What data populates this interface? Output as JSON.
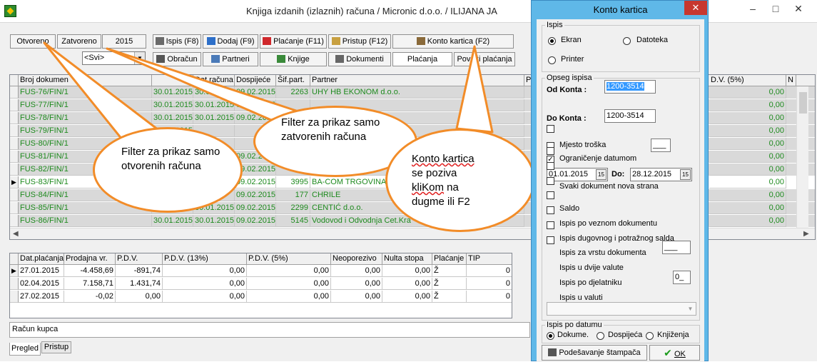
{
  "window": {
    "title": "Knjiga izdanih (izlaznih) računa / Micronic d.o.o.  / ILIJANA JA"
  },
  "toolbar": {
    "filters": [
      "Otvoreno",
      "Zatvoreno",
      "2015"
    ],
    "period_select": "<Svi>",
    "row1": [
      "Ispis (F8)",
      "Dodaj (F9)",
      "Plaćanje (F11)",
      "Pristup (F12)",
      "Konto kartica (F2)"
    ],
    "row2": [
      "Obračun",
      "Partneri",
      "Knjige",
      "Dokumenti",
      "Plaćanja",
      "Poveži plaćanja"
    ]
  },
  "main_grid": {
    "columns": [
      "Broj dokumen",
      "",
      "Dat.računa",
      "Dospijeće",
      "Šif.part.",
      "Partner"
    ],
    "right_columns": [
      "P",
      "D.V. (5%)",
      "N"
    ],
    "rows": [
      {
        "doc": "FUS-76/FIN/1",
        "date1": "30.01.2015",
        "date2": "30.01.2015",
        "due": "09.02.2015",
        "code": "2263",
        "partner": "UHY HB EKONOM d.o.o.",
        "amount": "0,00"
      },
      {
        "doc": "FUS-77/FIN/1",
        "date1": "30.01.2015",
        "date2": "30.01.2015",
        "due": "09.02.2015",
        "code": "",
        "partner": "",
        "amount": "0,00"
      },
      {
        "doc": "FUS-78/FIN/1",
        "date1": "30.01.2015",
        "date2": "30.01.2015",
        "due": "09.02.2015",
        "code": "",
        "partner": "",
        "amount": "0,00"
      },
      {
        "doc": "FUS-79/FIN/1",
        "date1": "30.01.2015",
        "date2": "",
        "due": "",
        "code": "",
        "partner": "",
        "amount": "0,00"
      },
      {
        "doc": "FUS-80/FIN/1",
        "date1": "",
        "date2": "",
        "due": "",
        "code": "",
        "partner": "",
        "amount": "0,00"
      },
      {
        "doc": "FUS-81/FIN/1",
        "date1": "",
        "date2": "",
        "due": "09.02.2015",
        "code": "",
        "partner": "",
        "amount": "0,00"
      },
      {
        "doc": "FUS-82/FIN/1",
        "date1": "",
        "date2": "",
        "due": "09.02.2015",
        "code": "",
        "partner": "",
        "amount": "0,00"
      },
      {
        "doc": "FUS-83/FIN/1",
        "date1": "",
        "date2": "",
        "due": "09.02.2015",
        "code": "3995",
        "partner": "BA-COM TRGOVINA d",
        "amount": "0,00"
      },
      {
        "doc": "FUS-84/FIN/1",
        "date1": "",
        "date2": "",
        "due": "09.02.2015",
        "code": "177",
        "partner": "CHRILE",
        "amount": "0,00"
      },
      {
        "doc": "FUS-85/FIN/1",
        "date1": "30.01.2015",
        "date2": "30.01.2015",
        "due": "09.02.2015",
        "code": "2299",
        "partner": "CENTIĆ d.o.o.",
        "amount": "0,00"
      },
      {
        "doc": "FUS-86/FIN/1",
        "date1": "30.01.2015",
        "date2": "30.01.2015",
        "due": "09.02.2015",
        "code": "5145",
        "partner": "Vodovod i Odvodnja Cet.Kra",
        "amount": "0,00"
      }
    ]
  },
  "payments_grid": {
    "columns": [
      "Dat.plaćanja",
      "Prodajna vr.",
      "P.D.V.",
      "P.D.V. (13%)",
      "P.D.V. (5%)",
      "Neoporezivo",
      "Nulta stopa",
      "Plaćanje",
      "TIP"
    ],
    "rows": [
      [
        "27.01.2015",
        "-4.458,69",
        "-891,74",
        "0,00",
        "0,00",
        "0,00",
        "0,00",
        "Ž",
        "0"
      ],
      [
        "02.04.2015",
        "7.158,71",
        "1.431,74",
        "0,00",
        "0,00",
        "0,00",
        "0,00",
        "Ž",
        "0"
      ],
      [
        "27.02.2015",
        "-0,02",
        "0,00",
        "0,00",
        "0,00",
        "0,00",
        "0,00",
        "Ž",
        "0"
      ]
    ]
  },
  "status_text": "Račun kupca",
  "bottom_tabs": [
    "Pregled",
    "Pristup"
  ],
  "callouts": {
    "open": "Filter za prikaz samo otvorenih računa",
    "closed": "Filter za prikaz samo zatvorenih računa",
    "konto_line1": "Konto kartica",
    "konto_line2": "se poziva",
    "konto_line3a": "kliKom",
    "konto_line3b": " na",
    "konto_line4": "dugme ili F2"
  },
  "dialog": {
    "title": "Konto kartica",
    "close": "✕",
    "ispis_group": "Ispis",
    "ispis_options": [
      "Ekran",
      "Datoteka",
      "Printer"
    ],
    "opseg_group": "Opseg ispisa",
    "od_konta_label": "Od Konta :",
    "od_konta_value": "1200-3514",
    "do_konta_label": "Do Konta :",
    "do_konta_value": "1200-3514",
    "mjesto_troska": "Mjesto troška",
    "mjesto_troska_value": "___",
    "ogranicenje": "Ograničenje datumom",
    "date_from": "01.01.2015",
    "do_label": "Do:",
    "date_to": "28.12.2015",
    "calendar_glyph": "15",
    "options": [
      "Svaki dokument nova strana",
      "Saldo",
      "Ispis po veznom dokumentu",
      "Ispis dugovnog i potražnog salda",
      "Ispis za  vrstu dokumenta",
      "Ispis u dvije valute",
      "Ispis po djelatniku",
      "Ispis u valuti"
    ],
    "vrsta_value": "___",
    "djelatnik_value": "0_",
    "datum_group": "Ispis po datumu",
    "datum_options": [
      "Dokume.",
      "Dospijeća",
      "Knjiženja"
    ],
    "print_setup": "Podešavanje štampača",
    "ok": "OK"
  }
}
